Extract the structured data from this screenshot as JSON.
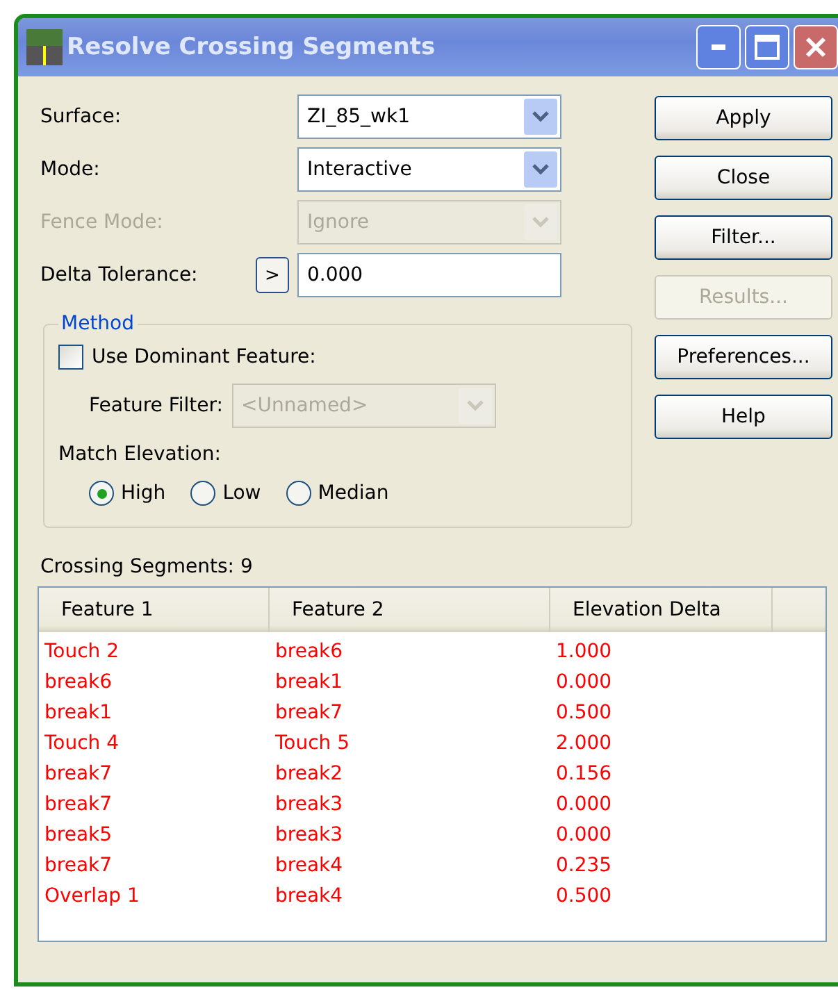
{
  "window": {
    "title": "Resolve Crossing Segments"
  },
  "fields": [
    {
      "kind": "combo",
      "label": "Surface:",
      "value": "ZI_85_wk1",
      "disabled": false
    },
    {
      "kind": "combo",
      "label": "Mode:",
      "value": "Interactive",
      "disabled": false
    },
    {
      "kind": "combo",
      "label": "Fence Mode:",
      "value": "Ignore",
      "disabled": true
    },
    {
      "kind": "text",
      "label": "Delta Tolerance:",
      "value": "0.000",
      "disabled": false,
      "button": ">"
    }
  ],
  "method": {
    "title": "Method",
    "dominant": {
      "label": "Use Dominant Feature:",
      "checked": false
    },
    "feature_filter": {
      "label": "Feature Filter:",
      "value": "<Unnamed>",
      "disabled": true
    },
    "match_label": "Match Elevation:",
    "options": [
      {
        "label": "High",
        "selected": true
      },
      {
        "label": "Low",
        "selected": false
      },
      {
        "label": "Median",
        "selected": false
      }
    ]
  },
  "buttons": [
    {
      "label": "Apply",
      "disabled": false
    },
    {
      "label": "Close",
      "disabled": false
    },
    {
      "label": "Filter...",
      "disabled": false
    },
    {
      "label": "Results...",
      "disabled": true
    },
    {
      "label": "Preferences...",
      "disabled": false
    },
    {
      "label": "Help",
      "disabled": false
    }
  ],
  "count_label": "Crossing Segments:",
  "count": "9",
  "table": {
    "columns": [
      "Feature 1",
      "Feature 2",
      "Elevation Delta"
    ],
    "rows": [
      [
        "Touch 2",
        "break6",
        "1.000"
      ],
      [
        "break6",
        "break1",
        "0.000"
      ],
      [
        "break1",
        "break7",
        "0.500"
      ],
      [
        "Touch 4",
        "Touch 5",
        "2.000"
      ],
      [
        "break7",
        "break2",
        "0.156"
      ],
      [
        "break7",
        "break3",
        "0.000"
      ],
      [
        "break5",
        "break3",
        "0.000"
      ],
      [
        "break7",
        "break4",
        "0.235"
      ],
      [
        "Overlap 1",
        "break4",
        "0.500"
      ]
    ]
  }
}
